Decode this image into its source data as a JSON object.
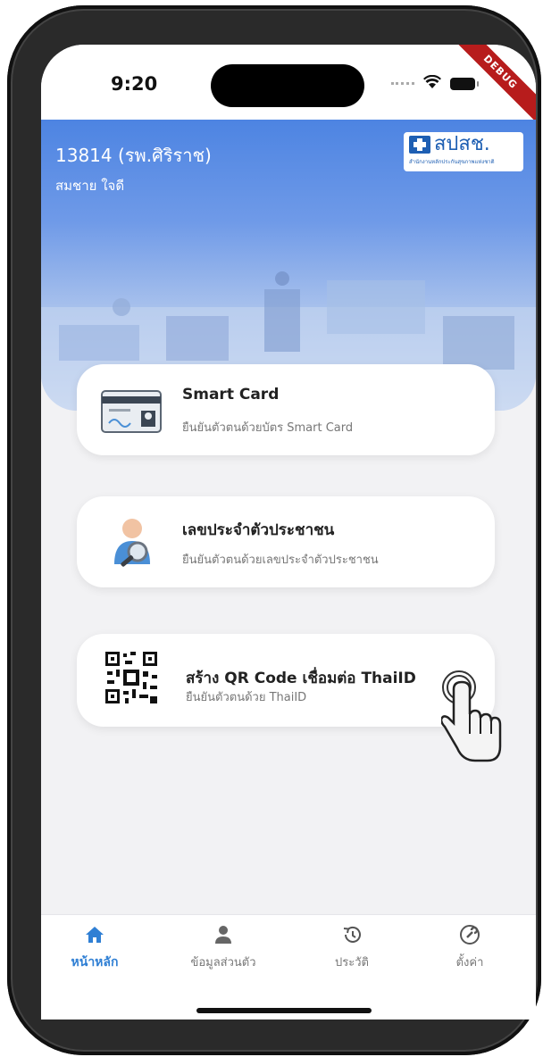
{
  "status_bar": {
    "time": "9:20",
    "debug_label": "DEBUG"
  },
  "header": {
    "hospital": "13814 (รพ.ศิริราช)",
    "user": "สมชาย ใจดี",
    "logo_text": "สปสช.",
    "logo_sub": "สำนักงานหลักประกันสุขภาพแห่งชาติ"
  },
  "cards": [
    {
      "title": "Smart Card",
      "subtitle": "ยืนยันตัวตนด้วยบัตร Smart Card",
      "icon": "id-card-icon"
    },
    {
      "title": "เลขประจำตัวประชาชน",
      "subtitle": "ยืนยันตัวตนด้วยเลขประจำตัวประชาชน",
      "icon": "person-search-icon"
    },
    {
      "title": "สร้าง QR Code เชื่อมต่อ ThaiID",
      "subtitle": "ยืนยันตัวตนด้วย ThaiID",
      "icon": "qr-code-icon"
    }
  ],
  "tabs": [
    {
      "label": "หน้าหลัก",
      "icon": "home-icon",
      "active": true
    },
    {
      "label": "ข้อมูลส่วนตัว",
      "icon": "person-icon",
      "active": false
    },
    {
      "label": "ประวัติ",
      "icon": "history-icon",
      "active": false
    },
    {
      "label": "ตั้งค่า",
      "icon": "settings-icon",
      "active": false
    }
  ],
  "colors": {
    "accent": "#2f7fd4",
    "header_top": "#4d84e2",
    "card_bg": "#ffffff",
    "screen_bg": "#f2f2f4"
  }
}
